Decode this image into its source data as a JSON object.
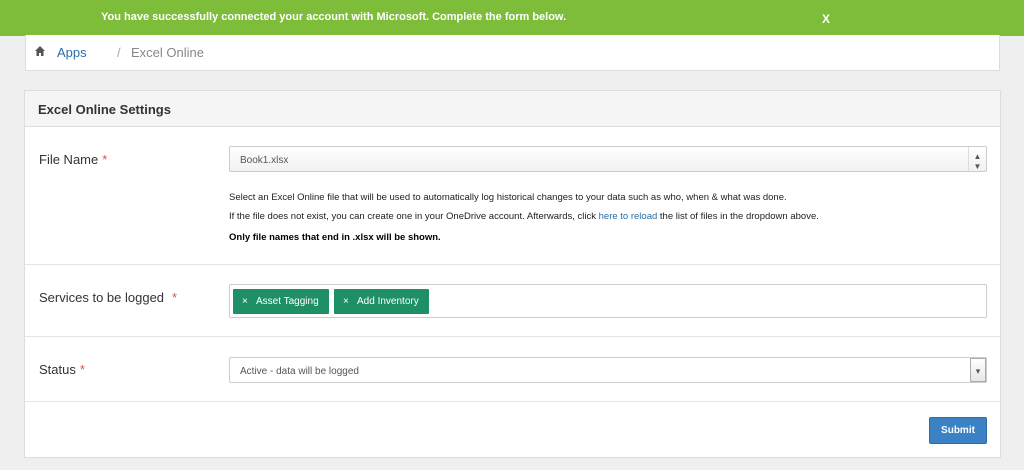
{
  "banner": {
    "message": "You have successfully connected your account with Microsoft. Complete the form below.",
    "close_label": "X",
    "color": "#7dbd3a"
  },
  "breadcrumb": {
    "home_icon": "home-icon",
    "apps": "Apps",
    "separator": "/",
    "current": "Excel Online"
  },
  "panel": {
    "title": "Excel Online Settings"
  },
  "form": {
    "file_name": {
      "label": "File Name",
      "required_mark": "*",
      "value": "Book1.xlsx",
      "arrow": "▲▼",
      "help_line1": "Select an Excel Online file that will be used to automatically log historical changes to your data such as who, when & what was done.",
      "help_line2_prefix": "If the file does not exist, you can create one in your OneDrive account. Afterwards, click ",
      "help_line2_link": "here to reload",
      "help_line2_suffix": " the list of files in the dropdown above.",
      "help_line3": "Only file names that end in .xlsx will be shown."
    },
    "services": {
      "label": "Services to be logged",
      "required_mark": "*",
      "tags": [
        {
          "remove": "×",
          "label": "Asset Tagging"
        },
        {
          "remove": "×",
          "label": "Add Inventory"
        }
      ],
      "tag_color": "#1f8f66"
    },
    "status": {
      "label": "Status",
      "required_mark": "*",
      "value": "Active - data will be logged",
      "arrow": "▾"
    },
    "submit_label": "Submit",
    "submit_color": "#3b82c4"
  }
}
